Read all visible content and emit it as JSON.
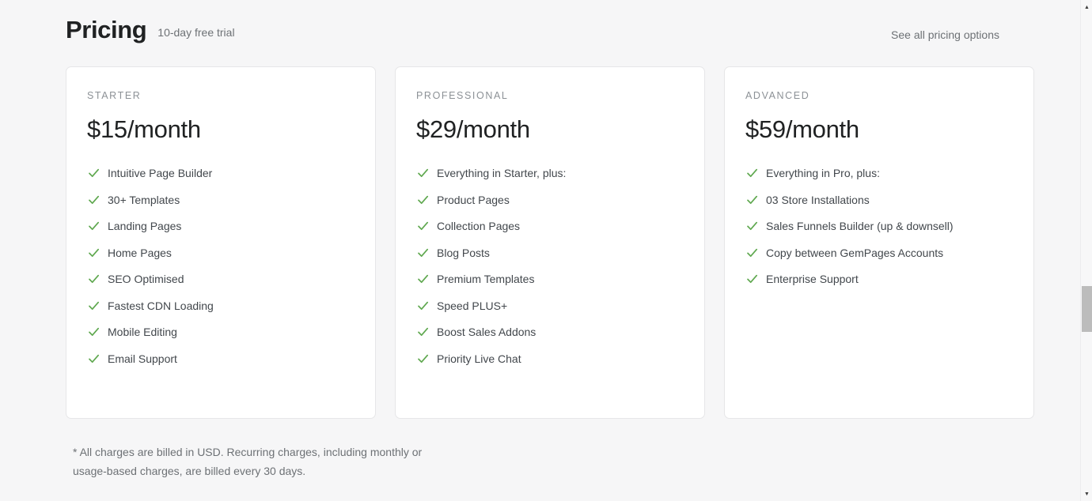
{
  "header": {
    "title": "Pricing",
    "subtitle": "10-day free trial",
    "link_label": "See all pricing options"
  },
  "plans": [
    {
      "name": "STARTER",
      "price": "$15/month",
      "features": [
        "Intuitive Page Builder",
        "30+ Templates",
        "Landing Pages",
        "Home Pages",
        "SEO Optimised",
        "Fastest CDN Loading",
        "Mobile Editing",
        "Email Support"
      ]
    },
    {
      "name": "PROFESSIONAL",
      "price": "$29/month",
      "features": [
        "Everything in Starter, plus:",
        "Product Pages",
        "Collection Pages",
        "Blog Posts",
        "Premium Templates",
        "Speed PLUS+",
        "Boost Sales Addons",
        "Priority Live Chat"
      ]
    },
    {
      "name": "ADVANCED",
      "price": "$59/month",
      "features": [
        "Everything in Pro, plus:",
        "03 Store Installations",
        "Sales Funnels Builder (up & downsell)",
        "Copy between GemPages Accounts",
        "Enterprise Support"
      ]
    }
  ],
  "footnote": "* All charges are billed in USD. Recurring charges, including monthly or usage-based charges, are billed every 30 days.",
  "icons": {
    "check": "check-icon",
    "scroll_up": "scroll-up-arrow-icon",
    "scroll_down": "scroll-down-arrow-icon"
  },
  "colors": {
    "page_background": "#f6f6f7",
    "card_background": "#ffffff",
    "card_border": "#e6e6e8",
    "title_text": "#202223",
    "muted_text": "#6d7175",
    "plan_label_text": "#8c9196",
    "feature_text": "#42474c",
    "check_green": "#5fa84f",
    "scrollbar_thumb": "#bcbcbc"
  }
}
